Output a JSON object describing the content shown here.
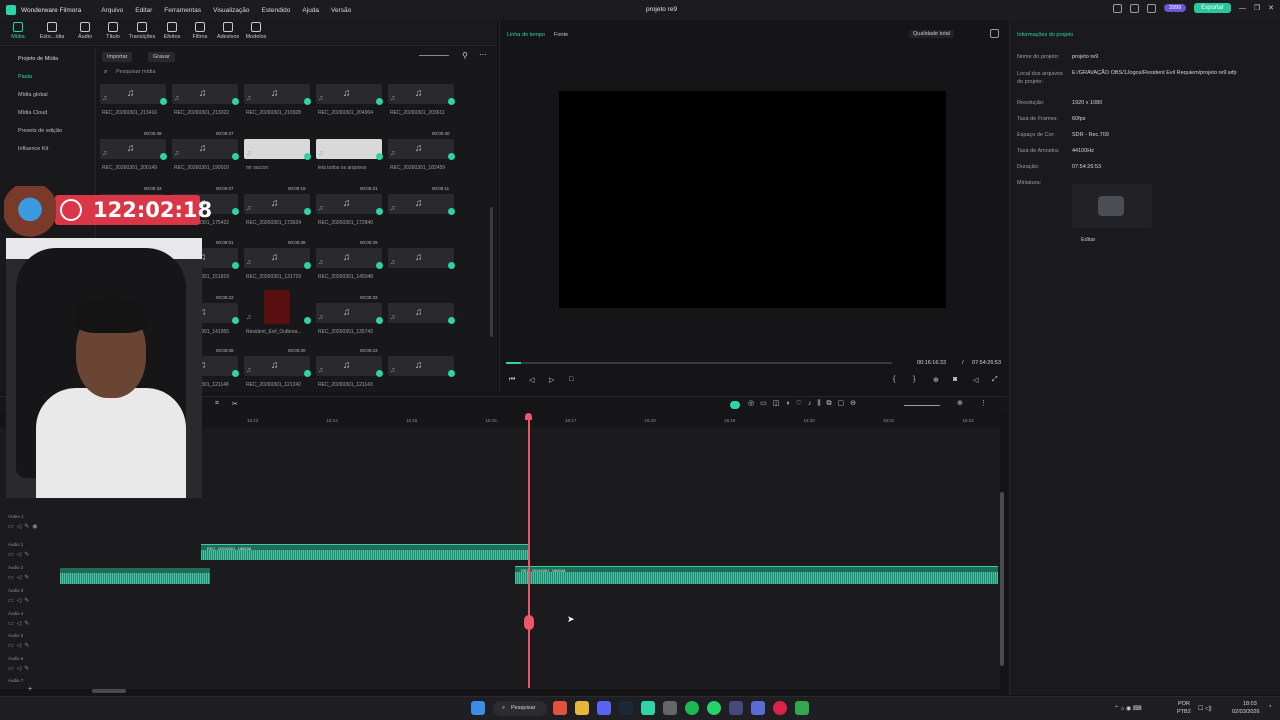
{
  "app": {
    "name": "Wonderware Filmora",
    "project_title": "projeto re9"
  },
  "menu": [
    "Arquivo",
    "Editar",
    "Ferramentas",
    "Visualização",
    "Estendido",
    "Ajuda",
    "Versão"
  ],
  "titlebar": {
    "credits": "3999",
    "export_label": "Exportar"
  },
  "toolbar_tools": [
    "Mídia",
    "Esto...ídia",
    "Áudio",
    "Título",
    "Transições",
    "Efeitos",
    "Filtros",
    "Adesivos",
    "Modelos"
  ],
  "sidebar": {
    "items": [
      "Projeto de Mídia",
      "Pasta",
      "Mídia global",
      "Mídia Cloud",
      "Presets de edição",
      "Influence Kit"
    ]
  },
  "media": {
    "import_label": "Importar",
    "record_label": "Gravar",
    "search_placeholder": "Pesquisar mídia",
    "files": [
      {
        "name": "REC_20260301_213416",
        "dur": ""
      },
      {
        "name": "REC_20260301_213022",
        "dur": ""
      },
      {
        "name": "REC_20260301_210928",
        "dur": ""
      },
      {
        "name": "REC_20260301_204904",
        "dur": ""
      },
      {
        "name": "REC_20260301_203611",
        "dur": ""
      },
      {
        "name": "REC_20260301_200149",
        "dur": "00:00:49"
      },
      {
        "name": "REC_20260301_190010",
        "dur": "00:00:37"
      },
      {
        "name": "mr raccon",
        "dur": ""
      },
      {
        "name": "leia todos os arquivos",
        "dur": ""
      },
      {
        "name": "REC_20260301_182459",
        "dur": "00:00:40"
      },
      {
        "name": "REC_20260301_180117",
        "dur": "00:00:33"
      },
      {
        "name": "REC_20260301_175422",
        "dur": "00:00:07"
      },
      {
        "name": "REC_20260301_173624",
        "dur": "00:00:15"
      },
      {
        "name": "REC_20260301_172840",
        "dur": "00:00:21"
      },
      {
        "name": "",
        "dur": "00:00:11"
      },
      {
        "name": "REC_20260301_153905",
        "dur": "00:00:26"
      },
      {
        "name": "REC_20260301_151819",
        "dur": "00:00:01"
      },
      {
        "name": "REC_20260301_131729",
        "dur": "00:00:38"
      },
      {
        "name": "REC_20260301_145048",
        "dur": "00:00:29"
      },
      {
        "name": "",
        "dur": ""
      },
      {
        "name": "REC_20260301_143235",
        "dur": "00:00:38"
      },
      {
        "name": "REC_20260301_141955",
        "dur": "00:00:22"
      },
      {
        "name": "Resident_Evil_Outbrea...",
        "dur": ""
      },
      {
        "name": "REC_20260301_135742",
        "dur": "00:00:33"
      },
      {
        "name": "",
        "dur": ""
      },
      {
        "name": "REC_20260301_123551",
        "dur": "00:00:29"
      },
      {
        "name": "REC_20260301_121148",
        "dur": "00:00:06"
      },
      {
        "name": "REC_20260301_121242",
        "dur": "00:00:20"
      },
      {
        "name": "REC_20260301_121143",
        "dur": "00:00:23"
      },
      {
        "name": "",
        "dur": ""
      }
    ]
  },
  "viewer": {
    "tabs": [
      "Linha do tempo",
      "Fonte"
    ],
    "quality": "Qualidade total",
    "current_time": "00:16:16:33",
    "total_time": "07:54:26:53",
    "progress": 0.04
  },
  "info": {
    "title": "Informações do projeto",
    "rows": [
      {
        "k": "Nome do projeto:",
        "v": "projeto re9"
      },
      {
        "k": "Local dos arquivos do projeto:",
        "v": "E:/GRAVAÇÃO OBS/1Jogos/Resident Evil Requiem/projeto re9.wfp"
      },
      {
        "k": "Resolução:",
        "v": "1920 x 1080"
      },
      {
        "k": "Taxa de Frames:",
        "v": "60fps"
      },
      {
        "k": "Espaço de Cor:",
        "v": "SDR - Rec.709"
      },
      {
        "k": "Taxa de Amostra:",
        "v": "44100Hz"
      },
      {
        "k": "Duração:",
        "v": "07:54:26:53"
      },
      {
        "k": "Miniatura:",
        "v": ""
      }
    ],
    "edit_label": "Editar"
  },
  "timeline": {
    "ticks": [
      "16:13",
      "16:14",
      "16:15",
      "16:16",
      "16:17",
      "16:18",
      "16:19",
      "16:20",
      "16:21",
      "16:22"
    ],
    "tracks": [
      "Vídeo 1",
      "Áudio 1",
      "Áudio 2",
      "Áudio 3",
      "Áudio 4",
      "Áudio 5",
      "Áudio 6",
      "Áudio 7"
    ],
    "clip_a": "REC_20260301_185838",
    "clip_b": "REC_20260301_185838"
  },
  "overlay": {
    "timer": "122:02:18"
  },
  "taskbar": {
    "search": "Pesquisar",
    "lang": "POR",
    "layout": "PTB2",
    "time": "18:03",
    "date": "02/03/2026"
  }
}
